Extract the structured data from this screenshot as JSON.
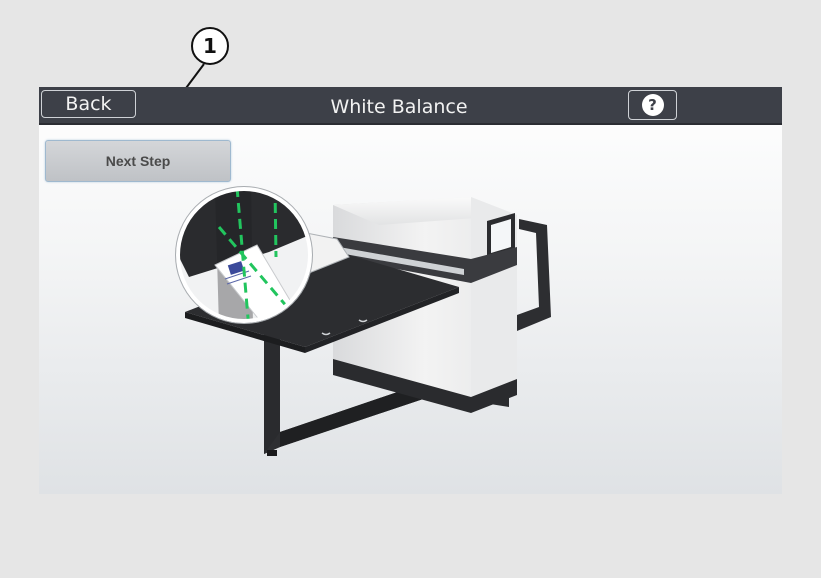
{
  "callout": {
    "number": "1"
  },
  "header": {
    "back_label": "Back",
    "title": "White Balance",
    "help_label": "?"
  },
  "main": {
    "next_step_label": "Next Step"
  },
  "colors": {
    "title_bar": "#3d4048",
    "guide_lines": "#22c55e"
  },
  "illustration": {
    "icon": "scanner-illustration"
  }
}
